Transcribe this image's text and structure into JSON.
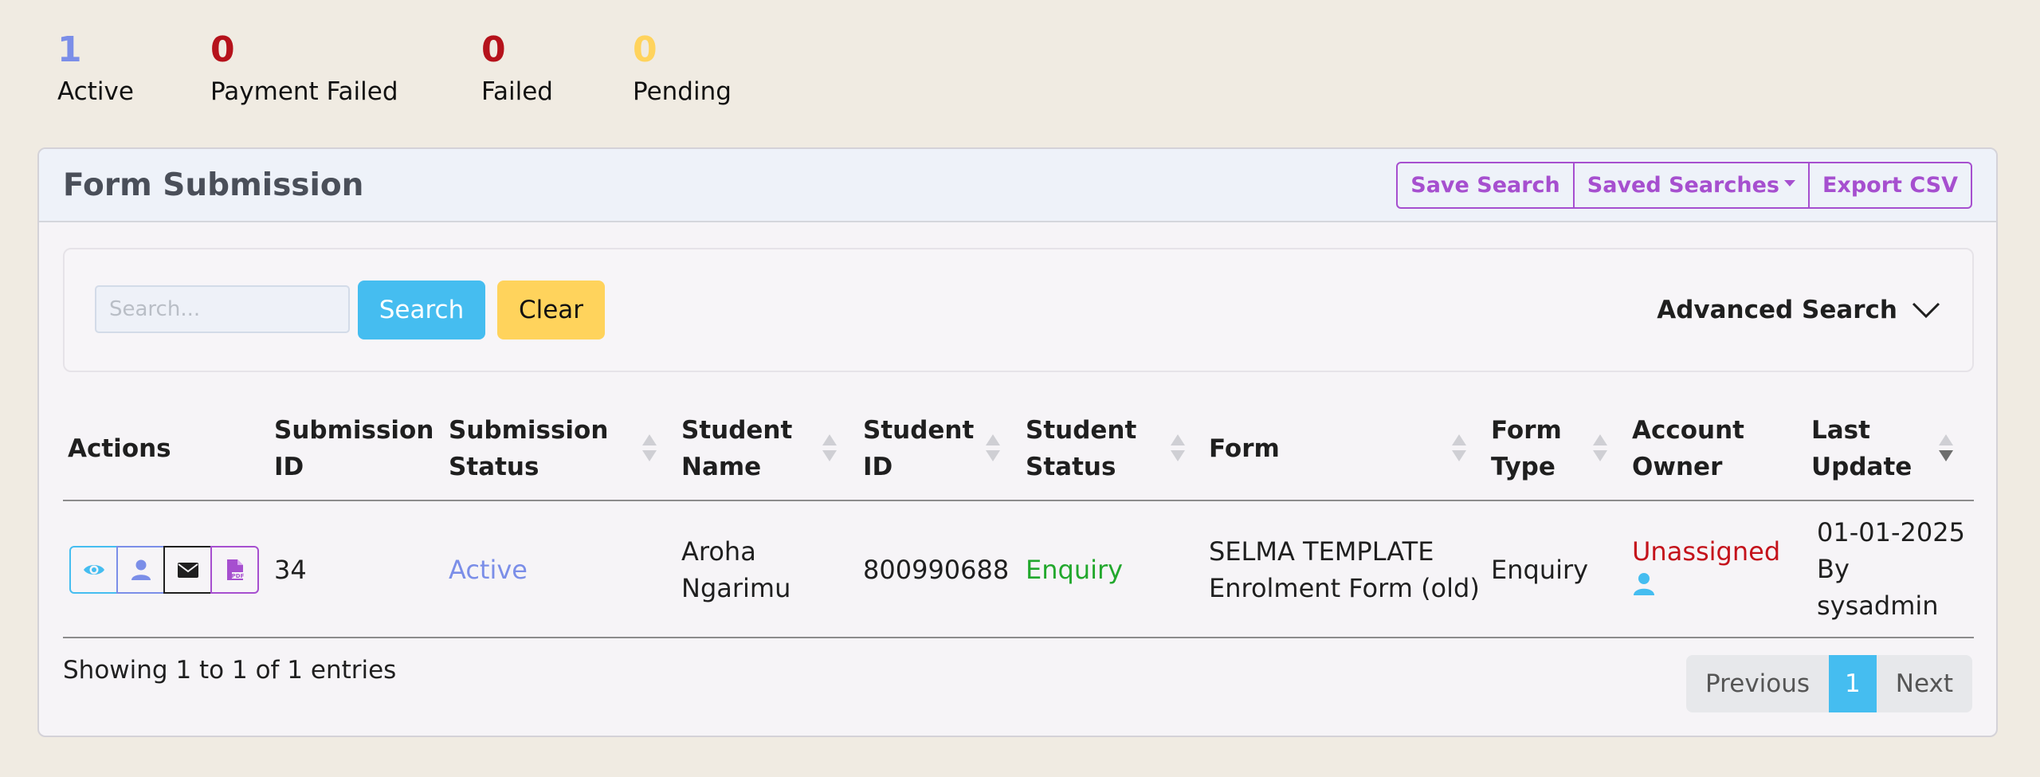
{
  "stats": [
    {
      "count": "1",
      "label": "Active",
      "color": "#7b8ee8"
    },
    {
      "count": "0",
      "label": "Payment Failed",
      "color": "#b5121b"
    },
    {
      "count": "0",
      "label": "Failed",
      "color": "#b5121b"
    },
    {
      "count": "0",
      "label": "Pending",
      "color": "#ffd35c"
    }
  ],
  "card": {
    "title": "Form Submission",
    "save_search_label": "Save Search",
    "saved_searches_label": "Saved Searches",
    "export_csv_label": "Export CSV"
  },
  "search": {
    "placeholder": "Search...",
    "value": "",
    "search_button": "Search",
    "clear_button": "Clear",
    "advanced_label": "Advanced Search"
  },
  "table": {
    "headers": {
      "actions": "Actions",
      "submission_id": [
        "Submission",
        "ID"
      ],
      "submission_status": [
        "Submission",
        "Status"
      ],
      "student_name": [
        "Student",
        "Name"
      ],
      "student_id": [
        "Student",
        "ID"
      ],
      "student_status": [
        "Student",
        "Status"
      ],
      "form": "Form",
      "form_type": [
        "Form",
        "Type"
      ],
      "account_owner": [
        "Account",
        "Owner"
      ],
      "last_update": [
        "Last",
        "Update"
      ]
    },
    "rows": [
      {
        "actions": [
          "eye-icon",
          "user-icon",
          "envelope-icon",
          "pdf-icon"
        ],
        "submission_id": "34",
        "submission_status": "Active",
        "student_name": [
          "Aroha",
          "Ngarimu"
        ],
        "student_id": "800990688",
        "student_status": "Enquiry",
        "form": [
          "SELMA TEMPLATE",
          "Enrolment Form (old)"
        ],
        "form_type": "Enquiry",
        "account_owner": "Unassigned",
        "last_update": [
          "01-01-2025",
          "By",
          "sysadmin"
        ]
      }
    ],
    "sorted_column": "last_update",
    "sort_direction": "desc"
  },
  "footer": {
    "info": "Showing 1 to 1 of 1 entries",
    "previous": "Previous",
    "current_page": "1",
    "next": "Next"
  },
  "colors": {
    "accent_purple": "#a64fcf",
    "accent_blue": "#45bdf0",
    "status_active": "#7b8ee8",
    "status_enquiry": "#22a82d",
    "status_unassigned": "#c4121b",
    "clear_yellow": "#ffd35c"
  }
}
